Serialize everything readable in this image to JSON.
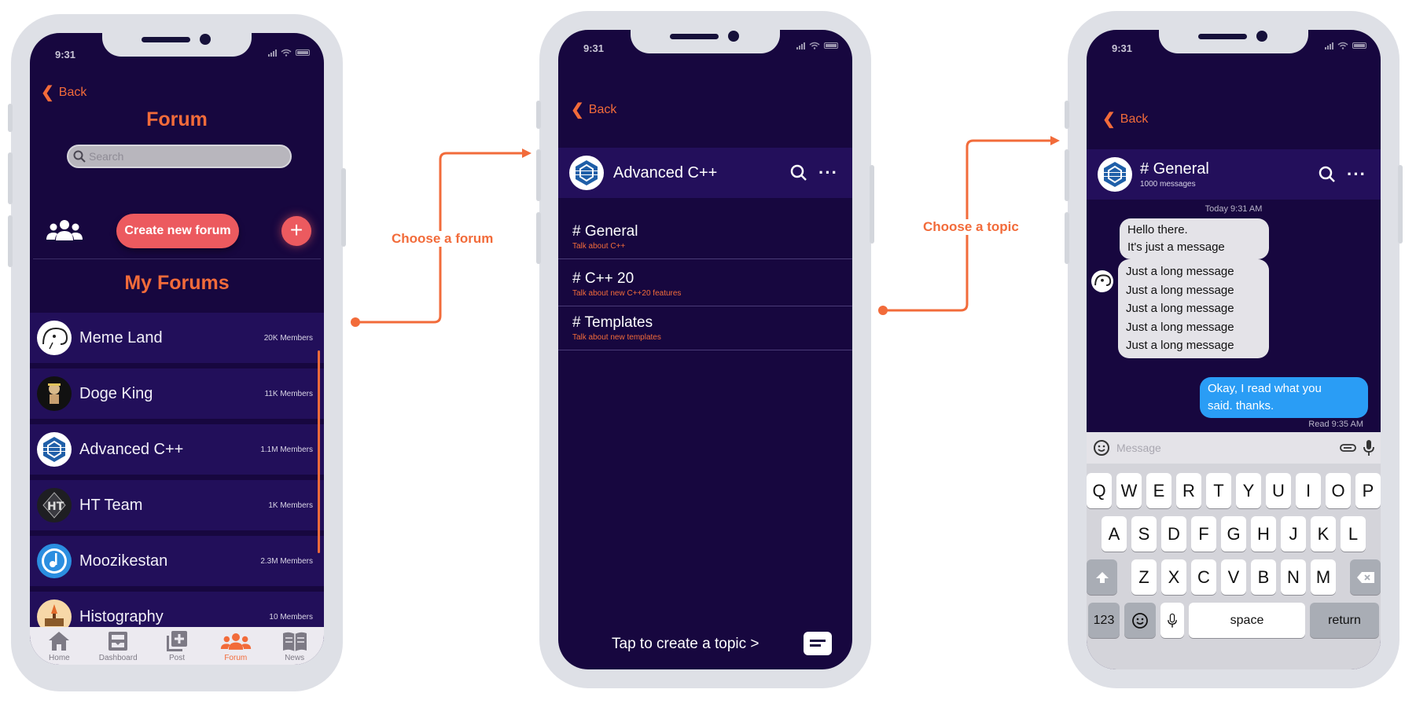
{
  "status_time": "9:31",
  "back_label": "Back",
  "screen1": {
    "title": "Forum",
    "search_placeholder": "Search",
    "create_button": "Create new forum",
    "plus_label": "+",
    "section_title": "My Forums",
    "forums": [
      {
        "name": "Meme Land",
        "members": "20K Members",
        "avatar": "meme-avatar"
      },
      {
        "name": "Doge King",
        "members": "11K Members",
        "avatar": "doge-avatar"
      },
      {
        "name": "Advanced C++",
        "members": "1.1M Members",
        "avatar": "cpp-logo"
      },
      {
        "name": "HT Team",
        "members": "1K Members",
        "avatar": "ht-logo"
      },
      {
        "name": "Moozikestan",
        "members": "2.3M Members",
        "avatar": "music-logo"
      },
      {
        "name": "Histography",
        "members": "10 Members",
        "avatar": "history-logo"
      }
    ],
    "tabs": [
      {
        "label": "Home",
        "icon": "home-icon"
      },
      {
        "label": "Dashboard",
        "icon": "dashboard-icon"
      },
      {
        "label": "Post",
        "icon": "post-icon"
      },
      {
        "label": "Forum",
        "icon": "forum-icon",
        "active": true
      },
      {
        "label": "News",
        "icon": "news-icon"
      }
    ]
  },
  "arrow1_label": "Choose a forum",
  "arrow2_label": "Choose a topic",
  "screen2": {
    "channel": "Advanced C++",
    "topics": [
      {
        "name": "# General",
        "desc": "Talk about C++"
      },
      {
        "name": "# C++ 20",
        "desc": "Talk about new C++20 features"
      },
      {
        "name": "# Templates",
        "desc": "Talk about new templates"
      }
    ],
    "create_topic": "Tap to create a topic >"
  },
  "screen3": {
    "channel": "# General",
    "subtitle": "1000 messages",
    "timestamp": "Today 9:31 AM",
    "msg1_line1": "Hello there.",
    "msg1_line2": "It's just a message",
    "long_lines": [
      "Just a long message",
      "Just a long message",
      "Just a long message",
      "Just a long message",
      "Just a long message"
    ],
    "reply_line1": "Okay, I read what you",
    "reply_line2": "said. thanks.",
    "read_status": "Read 9:35 AM",
    "message_placeholder": "Message",
    "keys_row1": [
      "Q",
      "W",
      "E",
      "R",
      "T",
      "Y",
      "U",
      "I",
      "O",
      "P"
    ],
    "keys_row2": [
      "A",
      "S",
      "D",
      "F",
      "G",
      "H",
      "J",
      "K",
      "L"
    ],
    "keys_row3": [
      "Z",
      "X",
      "C",
      "V",
      "B",
      "N",
      "M"
    ],
    "key_123": "123",
    "key_space": "space",
    "key_return": "return"
  },
  "colors": {
    "accent": "#f26b3a",
    "background": "#17073f",
    "button": "#ec5a5f",
    "bubble_out": "#2a9df5"
  }
}
